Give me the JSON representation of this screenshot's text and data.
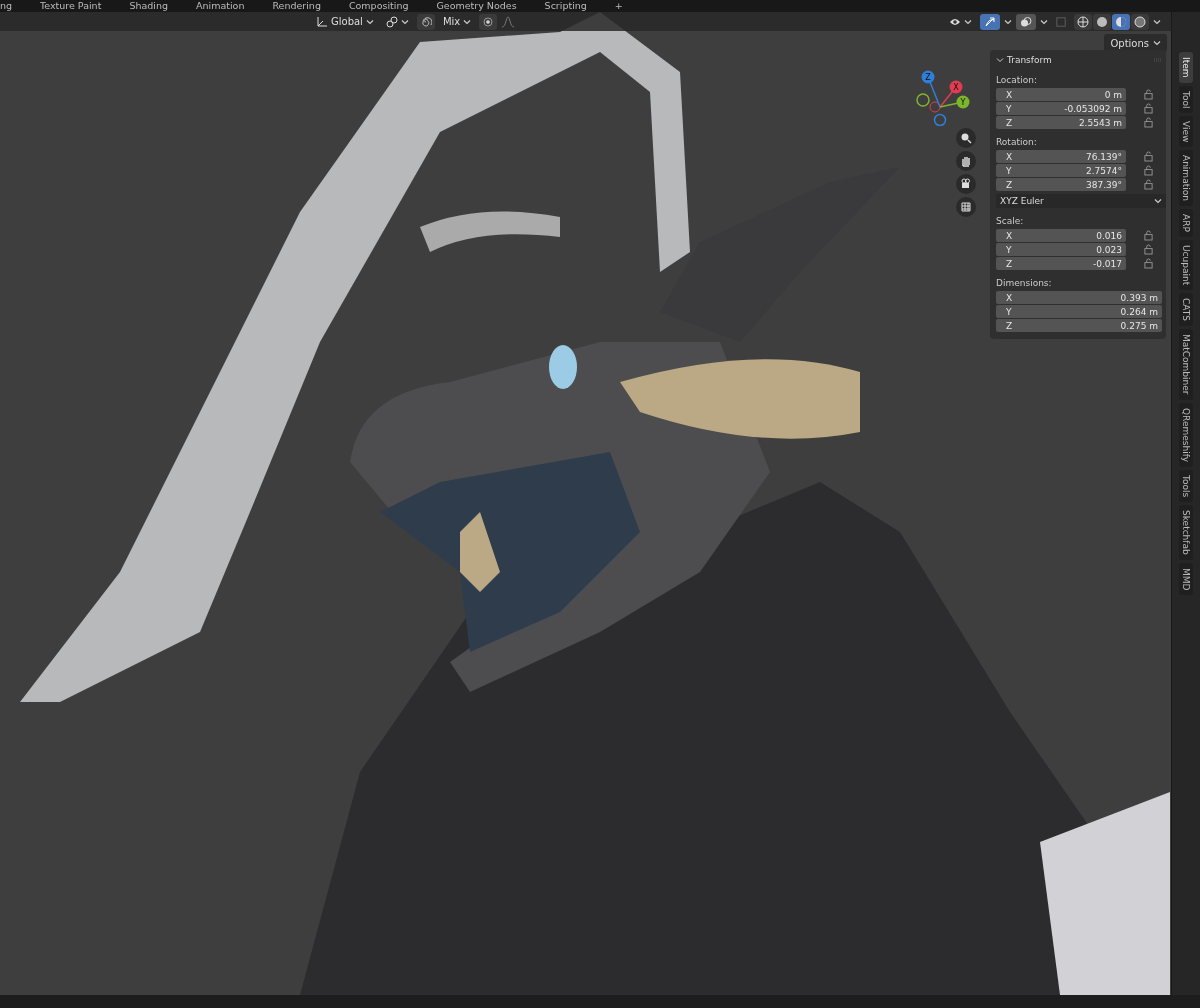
{
  "workspace_tabs": [
    "ng",
    "Texture Paint",
    "Shading",
    "Animation",
    "Rendering",
    "Compositing",
    "Geometry Nodes",
    "Scripting",
    "+"
  ],
  "header": {
    "orientation": "Global",
    "proportional_falloff": "Mix",
    "snap_on": false,
    "gizmos_on": true,
    "overlays_on": true,
    "shading_modes": [
      {
        "kind": "wireframe",
        "selected": false
      },
      {
        "kind": "solid",
        "selected": false
      },
      {
        "kind": "material",
        "selected": true
      },
      {
        "kind": "rendered",
        "selected": false
      }
    ]
  },
  "options_button": "Options",
  "transform": {
    "title": "Transform",
    "expanded": true,
    "groups": [
      {
        "kind": "vector",
        "label": "Location:",
        "rows": [
          {
            "axis": "X",
            "value": "0 m",
            "locked": false
          },
          {
            "axis": "Y",
            "value": "-0.053092 m",
            "locked": false
          },
          {
            "axis": "Z",
            "value": "2.5543 m",
            "locked": false
          }
        ]
      },
      {
        "kind": "vector",
        "label": "Rotation:",
        "rows": [
          {
            "axis": "X",
            "value": "76.139°",
            "locked": false
          },
          {
            "axis": "Y",
            "value": "2.7574°",
            "locked": false
          },
          {
            "axis": "Z",
            "value": "387.39°",
            "locked": false
          }
        ]
      },
      {
        "kind": "dropdown",
        "value": "XYZ Euler"
      },
      {
        "kind": "vector",
        "label": "Scale:",
        "rows": [
          {
            "axis": "X",
            "value": "0.016",
            "locked": false
          },
          {
            "axis": "Y",
            "value": "0.023",
            "locked": false
          },
          {
            "axis": "Z",
            "value": "-0.017",
            "locked": false
          }
        ]
      },
      {
        "kind": "vector",
        "label": "Dimensions:",
        "rows": [
          {
            "axis": "X",
            "value": "0.393 m"
          },
          {
            "axis": "Y",
            "value": "0.264 m"
          },
          {
            "axis": "Z",
            "value": "0.275 m"
          }
        ]
      }
    ]
  },
  "gizmo_axes": [
    "Z",
    "X",
    "Y"
  ],
  "side_tabs": [
    {
      "label": "Item",
      "selected": true
    },
    {
      "label": "Tool",
      "selected": false
    },
    {
      "label": "View",
      "selected": false
    },
    {
      "label": "Animation",
      "selected": false
    },
    {
      "label": "ARP",
      "selected": false
    },
    {
      "label": "Ucupaint",
      "selected": false
    },
    {
      "label": "CATS",
      "selected": false
    },
    {
      "label": "MatCombiner",
      "selected": false
    },
    {
      "label": "QRemeshify",
      "selected": false
    },
    {
      "label": "Tools",
      "selected": false
    },
    {
      "label": "Sketchfab",
      "selected": false
    },
    {
      "label": "MMD",
      "selected": false
    }
  ]
}
